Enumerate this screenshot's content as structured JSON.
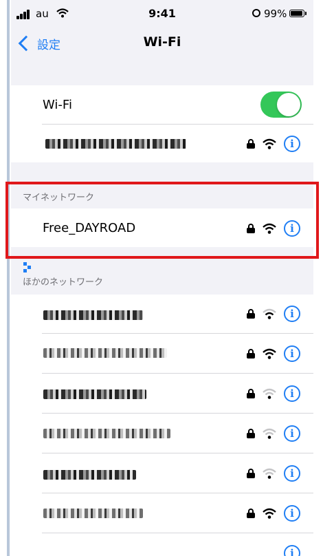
{
  "status_bar": {
    "carrier": "au",
    "time": "9:41",
    "battery": "99%"
  },
  "nav": {
    "back_label": "設定",
    "title": "Wi-Fi"
  },
  "wifi_toggle": {
    "label": "Wi-Fi",
    "on": true
  },
  "sections": {
    "my_networks": "マイネットワーク",
    "other_networks": "ほかのネットワーク"
  },
  "my_network": {
    "name": "Free_DAYROAD",
    "secured": true
  },
  "colors": {
    "accent": "#1f7ef4",
    "toggle_on": "#34c759",
    "highlight": "#e0181b"
  },
  "icons": [
    "chevron-left-icon",
    "lock-icon",
    "wifi-icon",
    "info-icon"
  ]
}
